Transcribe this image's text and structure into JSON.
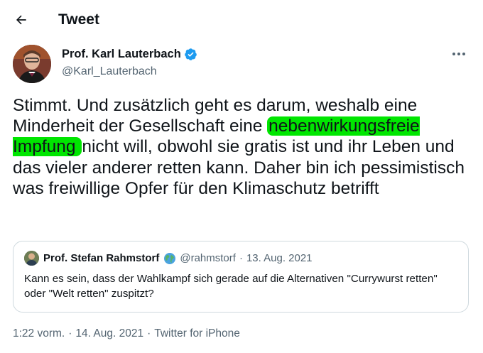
{
  "header": {
    "title": "Tweet",
    "back_icon": "arrow-left-icon"
  },
  "author": {
    "name": "Prof. Karl Lauterbach",
    "handle": "@Karl_Lauterbach",
    "verified_icon": "verified-badge-icon",
    "verified_color": "#1d9bf0"
  },
  "more_icon": "more-horizontal-icon",
  "tweet": {
    "segments": [
      {
        "text": "Stimmt. Und zusätzlich geht es darum, weshalb eine Minderheit der Gesellschaft eine ",
        "highlight": false
      },
      {
        "text": "nebenwirkungsfreie Impfung ",
        "highlight": true
      },
      {
        "text": "nicht will, obwohl sie gratis ist und ihr Leben und das vieler anderer retten kann. Daher bin ich pessimistisch was freiwillige Opfer für den Klimaschutz betrifft",
        "highlight": false
      }
    ],
    "highlight_color": "#00e600"
  },
  "quote": {
    "name": "Prof. Stefan Rahmstorf",
    "globe_icon": "globe-emoji-icon",
    "handle": "@rahmstorf",
    "separator": "·",
    "date": "13. Aug. 2021",
    "text": "Kann es sein, dass der Wahlkampf sich gerade auf die Alternativen \"Currywurst retten\" oder \"Welt retten\" zuspitzt?"
  },
  "meta": {
    "time": "1:22 vorm.",
    "separator": "·",
    "date": "14. Aug. 2021",
    "source": "Twitter for iPhone"
  },
  "colors": {
    "text": "#0f1419",
    "secondary": "#536471",
    "border": "#cfd9de"
  }
}
